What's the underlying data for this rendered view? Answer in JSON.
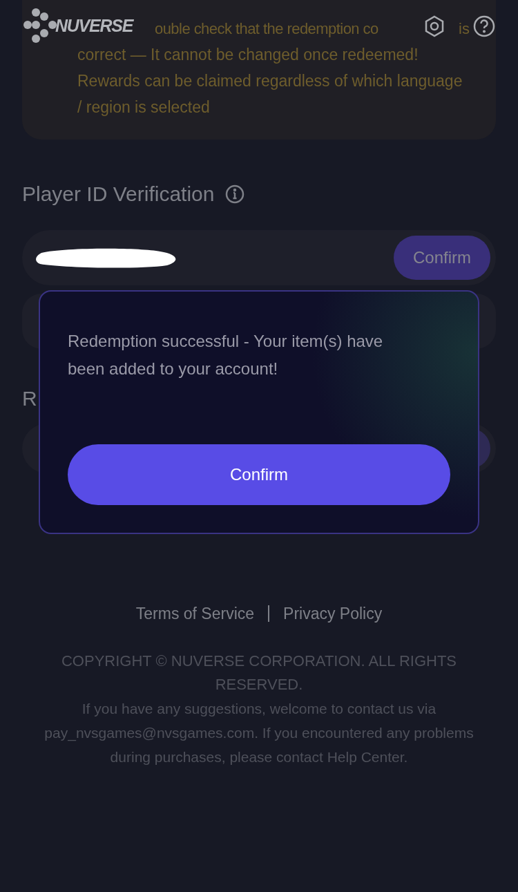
{
  "header": {
    "brand": "NUVERSE"
  },
  "notice": {
    "first_line": [
      "ouble check that the redemption co",
      "is"
    ],
    "text": "correct — It cannot be changed once redeemed! Rewards can be claimed regardless of which language / region is selected"
  },
  "player_id": {
    "heading": "Player ID Verification",
    "button": "Confirm"
  },
  "redemption": {
    "heading": "R"
  },
  "dialog": {
    "message": "Redemption successful - Your item(s) have been added to your account!",
    "button": "Confirm"
  },
  "footer": {
    "links": [
      "Terms of Service",
      "Privacy Policy"
    ],
    "copyright": "COPYRIGHT © NUVERSE CORPORATION. ALL RIGHTS RESERVED.",
    "contact": "If you have any suggestions, welcome to contact us via pay_nvsgames@nvsgames.com. If you encountered any problems during purchases, please contact Help Center."
  }
}
